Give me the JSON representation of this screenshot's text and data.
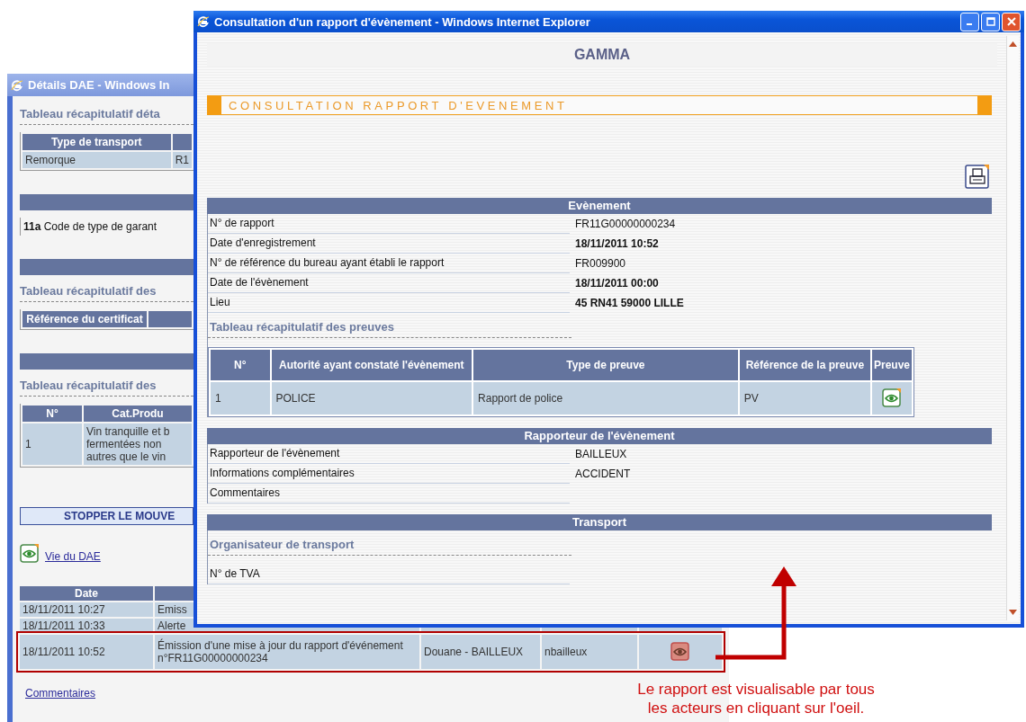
{
  "back_window": {
    "title": "Détails DAE - Windows In",
    "blocks": [
      {
        "kind": "subheading",
        "text": "Tableau récapitulatif déta"
      },
      {
        "kind": "table",
        "columns": [
          "Type de transport"
        ],
        "rows": [
          [
            "Remorque",
            "R1"
          ]
        ]
      },
      {
        "kind": "bar"
      },
      {
        "kind": "field",
        "text": "**11a** Code de type de garant"
      },
      {
        "kind": "bar"
      },
      {
        "kind": "subheading",
        "text": "Tableau récapitulatif des"
      },
      {
        "kind": "table",
        "columns": [
          "Référence du certificat"
        ]
      },
      {
        "kind": "bar"
      },
      {
        "kind": "subheading",
        "text": "Tableau récapitulatif des"
      },
      {
        "kind": "table",
        "columns": [
          "N°",
          "Cat.Produ"
        ],
        "rows": [
          [
            "1",
            "Vin tranquille et b\nfermentées non\nautres que le vin"
          ]
        ]
      }
    ],
    "stop_button": "STOPPER LE MOUVE",
    "history_link": "Vie du DAE",
    "history": {
      "columns": [
        "Date"
      ],
      "rows": [
        {
          "cells": [
            "18/11/2011 10:27",
            "Emiss"
          ],
          "viewable": false,
          "highlighted": false
        },
        {
          "cells": [
            "18/11/2011 10:33",
            "Alerte"
          ],
          "viewable": false,
          "highlighted": false
        },
        {
          "cells": [
            "18/11/2011 10:52",
            "Émission d'une mise à jour du rapport d'événement n°FR11G00000000234",
            "Douane - BAILLEUX",
            "nbailleux"
          ],
          "viewable": true,
          "highlighted": true
        }
      ]
    },
    "comments_link": "Commentaires"
  },
  "front_window": {
    "title": "Consultation d'un rapport d'évènement - Windows Internet Explorer",
    "app_name": "GAMMA",
    "page_title": "CONSULTATION RAPPORT D'EVENEMENT",
    "sections": [
      {
        "title": "Evènement",
        "blocks": [
          {
            "kind": "field",
            "label": "N° de rapport",
            "value": "FR11G00000000234",
            "bold": false
          },
          {
            "kind": "field",
            "label": "Date d'enregistrement",
            "value": "18/11/2011 10:52",
            "bold": true
          },
          {
            "kind": "field",
            "label": "N° de référence du bureau ayant établi le rapport",
            "value": "FR009900",
            "bold": false
          },
          {
            "kind": "field",
            "label": "Date de l'évènement",
            "value": "18/11/2011 00:00",
            "bold": true
          },
          {
            "kind": "field",
            "label": "Lieu",
            "value": "45 RN41 59000 LILLE",
            "bold": true
          },
          {
            "kind": "subheading",
            "text": "Tableau récapitulatif des preuves"
          },
          {
            "kind": "table",
            "columns": [
              "N°",
              "Autorité ayant constaté l'évènement",
              "Type de preuve",
              "Référence de la preuve",
              "Preuve"
            ],
            "rows": [
              {
                "cells": [
                  "1",
                  "POLICE",
                  "Rapport de police",
                  "PV"
                ],
                "proof": true
              }
            ]
          }
        ]
      },
      {
        "title": "Rapporteur de l'évènement",
        "blocks": [
          {
            "kind": "field",
            "label": "Rapporteur de l'évènement",
            "value": "BAILLEUX",
            "bold": false
          },
          {
            "kind": "field",
            "label": "Informations complémentaires",
            "value": "ACCIDENT",
            "bold": false
          },
          {
            "kind": "field",
            "label": "Commentaires"
          }
        ]
      },
      {
        "title": "Transport",
        "blocks": [
          {
            "kind": "subheading",
            "text": "Organisateur de transport"
          },
          {
            "kind": "field",
            "label": "N° de TVA"
          }
        ]
      }
    ]
  },
  "annotation": {
    "text": "Le rapport est visualisable par tous\nles acteurs en cliquant sur l'oeil."
  }
}
